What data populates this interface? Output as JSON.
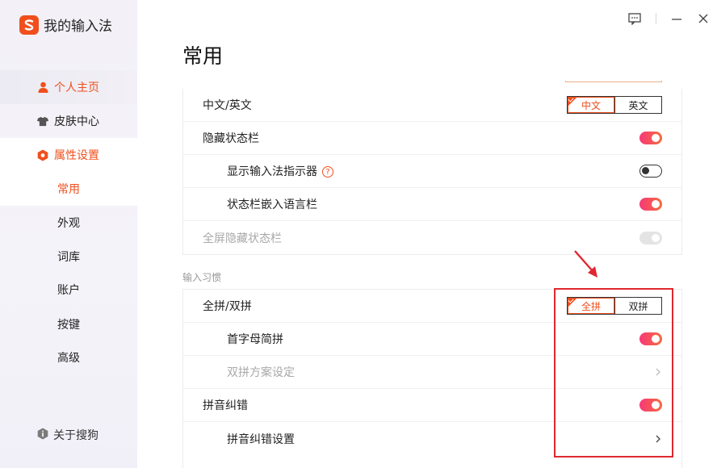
{
  "app": {
    "title": "我的输入法"
  },
  "window": {
    "feedback_icon": "feedback-icon",
    "minimize_icon": "minimize-icon",
    "close_icon": "close-icon"
  },
  "sidebar": {
    "items": [
      {
        "label": "个人主页",
        "icon": "user-icon"
      },
      {
        "label": "皮肤中心",
        "icon": "shirt-icon"
      },
      {
        "label": "属性设置",
        "icon": "hexagon-gear-icon"
      }
    ],
    "sub_items": [
      {
        "label": "常用"
      },
      {
        "label": "外观"
      },
      {
        "label": "词库"
      },
      {
        "label": "账户"
      },
      {
        "label": "按键"
      },
      {
        "label": "高级"
      }
    ],
    "about": {
      "label": "关于搜狗",
      "icon": "info-icon"
    }
  },
  "main": {
    "title": "常用",
    "panel1": {
      "rows": [
        {
          "label": "中文/英文",
          "control": "segmented",
          "options": [
            "中文",
            "英文"
          ],
          "selected": "中文"
        },
        {
          "label": "隐藏状态栏",
          "control": "toggle",
          "state": "on"
        },
        {
          "label": "显示输入法指示器",
          "control": "toggle",
          "state": "off",
          "help": "?"
        },
        {
          "label": "状态栏嵌入语言栏",
          "control": "toggle",
          "state": "on"
        },
        {
          "label": "全屏隐藏状态栏",
          "control": "toggle",
          "state": "disabled"
        }
      ]
    },
    "section2_label": "输入习惯",
    "panel2": {
      "rows": [
        {
          "label": "全拼/双拼",
          "control": "segmented",
          "options": [
            "全拼",
            "双拼"
          ],
          "selected": "全拼"
        },
        {
          "label": "首字母简拼",
          "control": "toggle",
          "state": "on"
        },
        {
          "label": "双拼方案设定",
          "control": "chevron",
          "disabled": true
        },
        {
          "label": "拼音纠错",
          "control": "toggle",
          "state": "on"
        },
        {
          "label": "拼音纠错设置",
          "control": "chevron"
        }
      ]
    }
  },
  "colors": {
    "accent": "#f04f1d",
    "toggle_start": "#f7397a",
    "toggle_end": "#f46d3b",
    "annotation": "#e0282f"
  }
}
